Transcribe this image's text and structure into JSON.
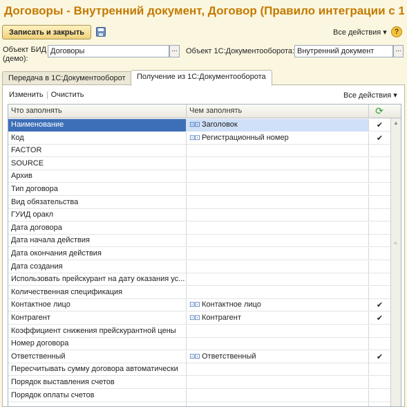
{
  "window": {
    "title": "Договоры - Внутренний документ, Договор (Правило интеграции с 1..."
  },
  "toolbar": {
    "save_close_label": "Записать и закрыть",
    "all_actions_label": "Все действия ▾",
    "help_label": "?"
  },
  "fields": {
    "bid_label": "Объект БИД\n(демо):",
    "bid_value": "Договоры",
    "doc_label": "Объект 1С:Документооборота:",
    "doc_value": "Внутренний документ",
    "ellipsis": "..."
  },
  "tabs": [
    {
      "label": "Передача в 1С:Документооборот",
      "active": false
    },
    {
      "label": "Получение из 1С:Документооборота",
      "active": true
    }
  ],
  "panel": {
    "edit_label": "Изменить",
    "clear_label": "Очистить",
    "all_actions_label": "Все действия ▾"
  },
  "table": {
    "columns": [
      "Что заполнять",
      "Чем заполнять"
    ],
    "rows": [
      {
        "what": "Наименование",
        "with": "Заголовок",
        "checked": true,
        "selected": true
      },
      {
        "what": "Код",
        "with": "Регистрационный номер",
        "checked": true
      },
      {
        "what": "FACTOR",
        "with": "",
        "checked": false
      },
      {
        "what": "SOURCE",
        "with": "",
        "checked": false
      },
      {
        "what": "Архив",
        "with": "",
        "checked": false
      },
      {
        "what": "Тип договора",
        "with": "",
        "checked": false
      },
      {
        "what": "Вид обязательства",
        "with": "",
        "checked": false
      },
      {
        "what": "ГУИД оракл",
        "with": "",
        "checked": false
      },
      {
        "what": "Дата договора",
        "with": "",
        "checked": false
      },
      {
        "what": "Дата начала действия",
        "with": "",
        "checked": false
      },
      {
        "what": "Дата окончания действия",
        "with": "",
        "checked": false
      },
      {
        "what": "Дата создания",
        "with": "",
        "checked": false
      },
      {
        "what": "Использовать прейскурант на дату оказания ус...",
        "with": "",
        "checked": false
      },
      {
        "what": "Количественная спецификация",
        "with": "",
        "checked": false
      },
      {
        "what": "Контактное лицо",
        "with": "Контактное лицо",
        "checked": true
      },
      {
        "what": "Контрагент",
        "with": "Контрагент",
        "checked": true
      },
      {
        "what": "Коэффициент снижения прейскурантной цены",
        "with": "",
        "checked": false
      },
      {
        "what": "Номер договора",
        "with": "",
        "checked": false
      },
      {
        "what": "Ответственный",
        "with": "Ответственный",
        "checked": true
      },
      {
        "what": "Пересчитывать сумму договора автоматически",
        "with": "",
        "checked": false
      },
      {
        "what": "Порядок выставления счетов",
        "with": "",
        "checked": false
      },
      {
        "what": "Порядок оплаты счетов",
        "with": "",
        "checked": false
      },
      {
        "what": "",
        "with": "",
        "checked": false
      }
    ]
  },
  "icons": {
    "check": "✔",
    "link": "⊡⊡",
    "refresh": "⟳"
  },
  "colors": {
    "title": "#c37a00",
    "selected_row": "#3d6fb8",
    "selected_cell": "#cfe0f7",
    "background": "#fbf6e0"
  }
}
